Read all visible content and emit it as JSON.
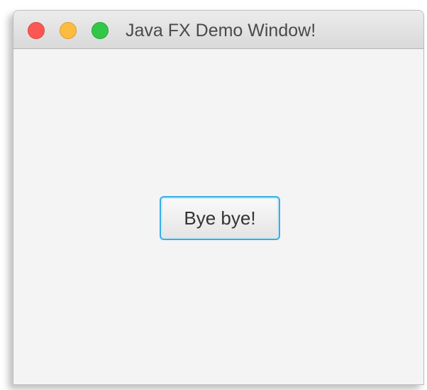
{
  "window": {
    "title": "Java FX Demo Window!",
    "controls": {
      "close_icon": "close-icon",
      "minimize_icon": "minimize-icon",
      "maximize_icon": "maximize-icon",
      "close_color": "#fc5753",
      "minimize_color": "#fdbc40",
      "maximize_color": "#33c748"
    }
  },
  "content": {
    "button_label": "Bye bye!",
    "button_focus_color": "#39aee3"
  }
}
